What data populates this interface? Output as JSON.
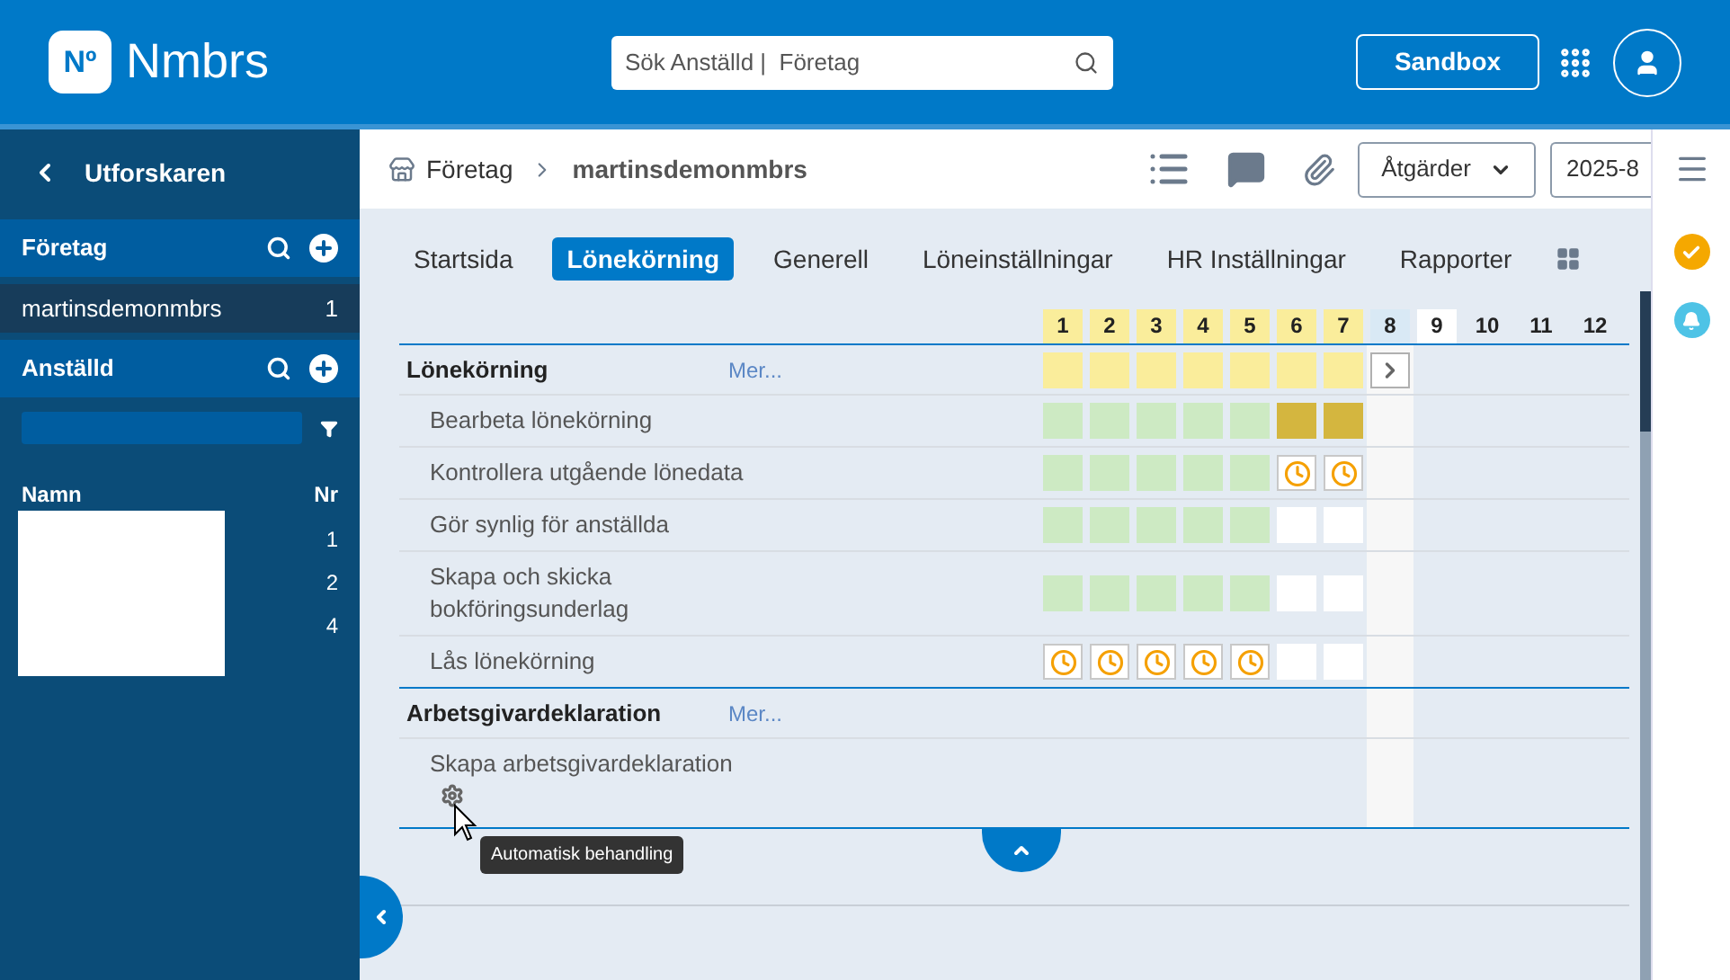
{
  "header": {
    "logo_mark": "Nº",
    "logo_text": "Nmbrs",
    "search": {
      "placeholder": "Sök Anställd |  Företag"
    },
    "sandbox_button": "Sandbox"
  },
  "sidebar": {
    "title": "Utforskaren",
    "company_section": {
      "title": "Företag",
      "items": [
        {
          "name": "martinsdemonmbrs",
          "count": "1",
          "selected": true
        }
      ]
    },
    "employee_section": {
      "title": "Anställd",
      "columns": [
        "Namn",
        "Nr"
      ],
      "numbers": [
        "1",
        "2",
        "4"
      ]
    }
  },
  "breadcrumb": [
    "Företag",
    "martinsdemonmbrs"
  ],
  "toolbar": {
    "actions_button": "Åtgärder",
    "period_button": "2025-8"
  },
  "tabs": [
    {
      "label": "Startsida",
      "selected": false
    },
    {
      "label": "Lönekörning",
      "selected": true
    },
    {
      "label": "Generell",
      "selected": false
    },
    {
      "label": "Löneinställningar",
      "selected": false
    },
    {
      "label": "HR Inställningar",
      "selected": false
    },
    {
      "label": "Rapporter",
      "selected": false
    }
  ],
  "months": [
    {
      "label": "1",
      "kind": "past"
    },
    {
      "label": "2",
      "kind": "past"
    },
    {
      "label": "3",
      "kind": "past"
    },
    {
      "label": "4",
      "kind": "past"
    },
    {
      "label": "5",
      "kind": "past"
    },
    {
      "label": "6",
      "kind": "past"
    },
    {
      "label": "7",
      "kind": "past"
    },
    {
      "label": "8",
      "kind": "current"
    },
    {
      "label": "9",
      "kind": "next"
    },
    {
      "label": "10",
      "kind": "future"
    },
    {
      "label": "11",
      "kind": "future"
    },
    {
      "label": "12",
      "kind": "future"
    }
  ],
  "sections": [
    {
      "title": "Lönekörning",
      "more": "Mer...",
      "cells": [
        {
          "kind": "pending"
        },
        {
          "kind": "pending"
        },
        {
          "kind": "pending"
        },
        {
          "kind": "pending"
        },
        {
          "kind": "pending"
        },
        {
          "kind": "pending"
        },
        {
          "kind": "pending"
        },
        {
          "kind": "next"
        }
      ],
      "tasks": [
        {
          "label": "Bearbeta lönekörning",
          "automatic": false,
          "cells": [
            {
              "kind": "done"
            },
            {
              "kind": "done"
            },
            {
              "kind": "done"
            },
            {
              "kind": "done"
            },
            {
              "kind": "done"
            },
            {
              "kind": "warning"
            },
            {
              "kind": "warning"
            }
          ]
        },
        {
          "label": "Kontrollera utgående lönedata",
          "automatic": false,
          "cells": [
            {
              "kind": "done"
            },
            {
              "kind": "done"
            },
            {
              "kind": "done"
            },
            {
              "kind": "done"
            },
            {
              "kind": "done"
            },
            {
              "kind": "clock"
            },
            {
              "kind": "clock"
            }
          ]
        },
        {
          "label": "Gör synlig för anställda",
          "automatic": false,
          "cells": [
            {
              "kind": "done"
            },
            {
              "kind": "done"
            },
            {
              "kind": "done"
            },
            {
              "kind": "done"
            },
            {
              "kind": "done"
            },
            {
              "kind": "empty"
            },
            {
              "kind": "empty"
            }
          ]
        },
        {
          "label": "Skapa och skicka bokföringsunderlag",
          "automatic": false,
          "cells": [
            {
              "kind": "done"
            },
            {
              "kind": "done"
            },
            {
              "kind": "done"
            },
            {
              "kind": "done"
            },
            {
              "kind": "done"
            },
            {
              "kind": "empty"
            },
            {
              "kind": "empty"
            }
          ]
        },
        {
          "label": "Lås lönekörning",
          "automatic": false,
          "cells": [
            {
              "kind": "clock"
            },
            {
              "kind": "clock"
            },
            {
              "kind": "clock"
            },
            {
              "kind": "clock"
            },
            {
              "kind": "clock"
            },
            {
              "kind": "empty"
            },
            {
              "kind": "empty"
            }
          ]
        }
      ]
    },
    {
      "title": "Arbetsgivardeklaration",
      "more": "Mer...",
      "tasks": [
        {
          "label": "Skapa arbetsgivardeklaration",
          "automatic": true
        }
      ]
    }
  ],
  "tooltip": "Automatisk behandling"
}
